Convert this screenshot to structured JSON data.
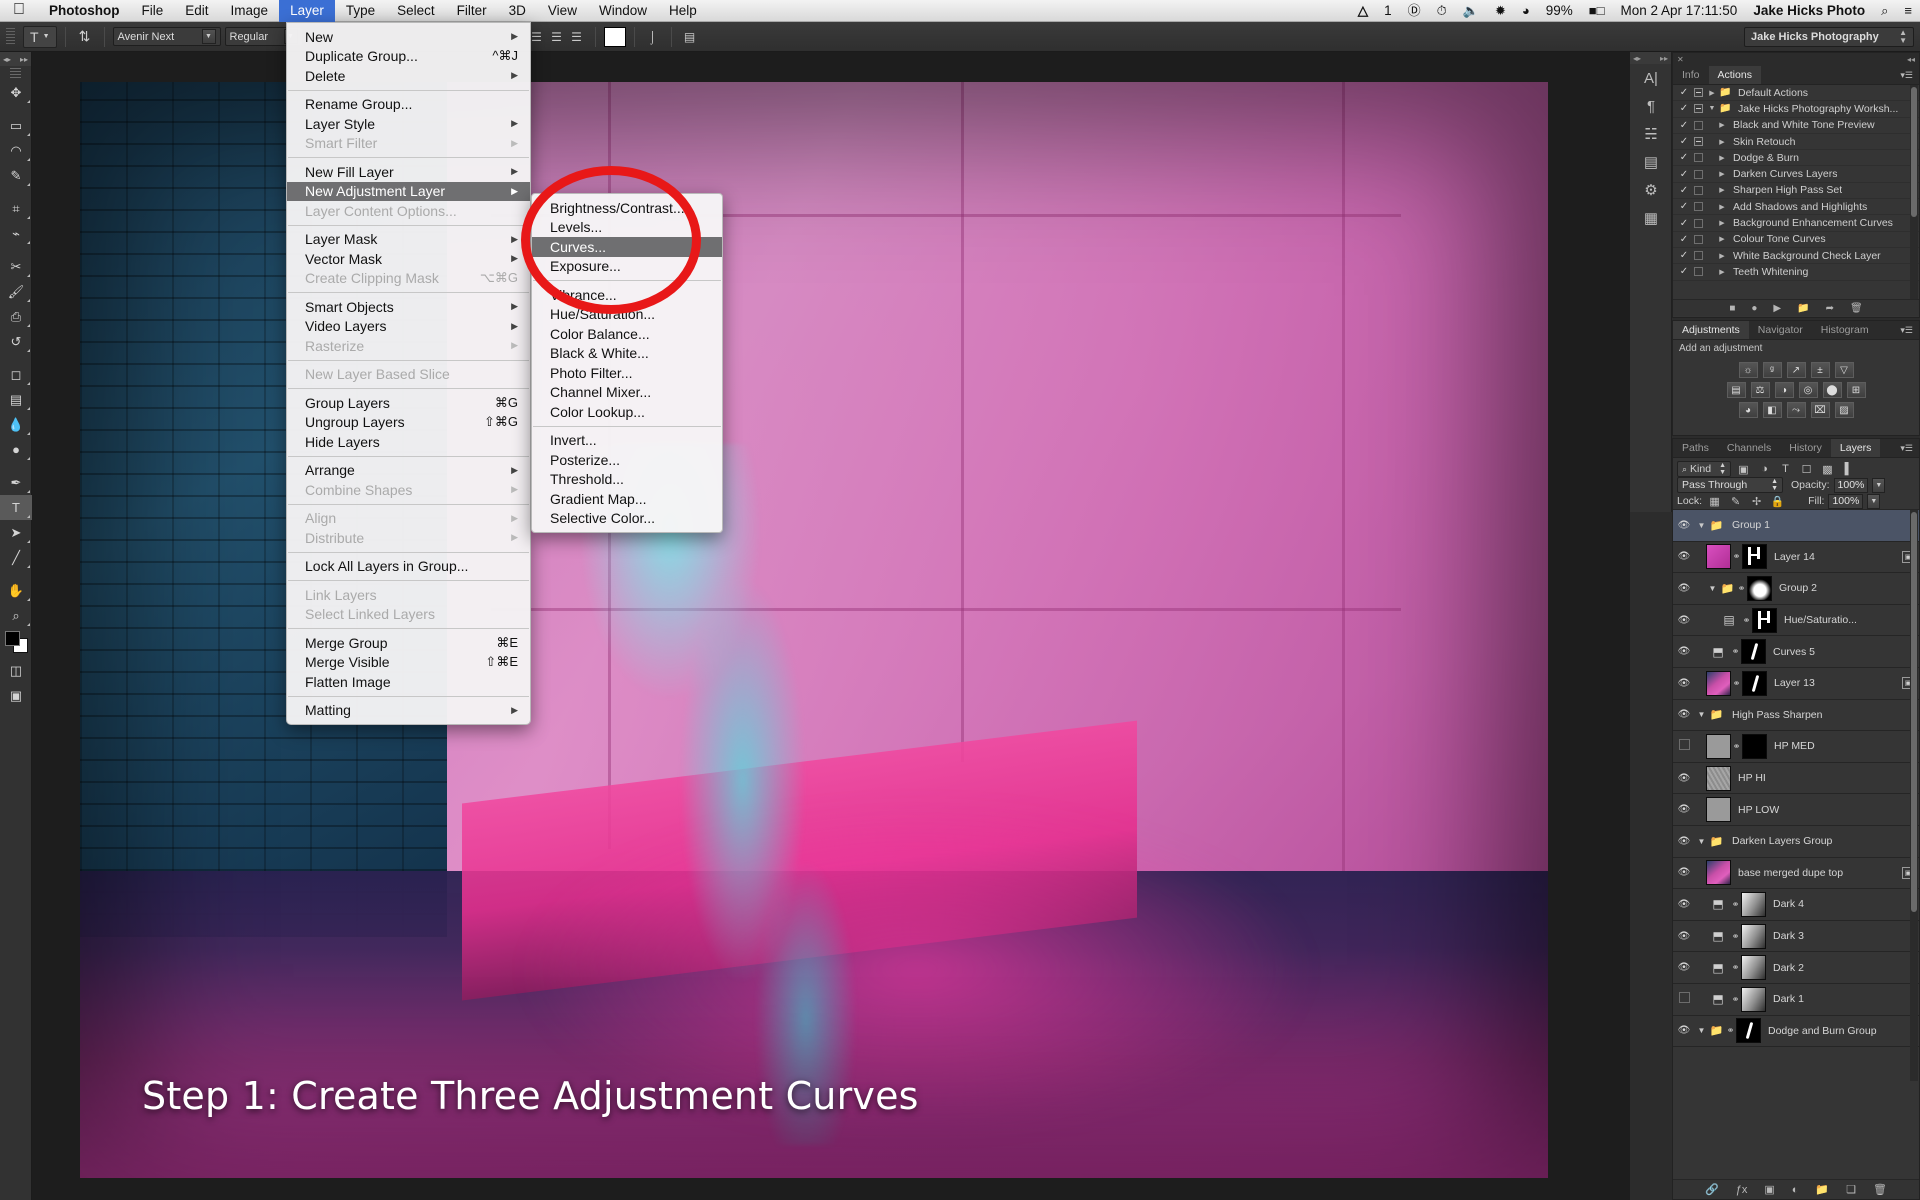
{
  "macbar": {
    "apple_icon": "apple-icon",
    "app_name": "Photoshop",
    "menus": [
      "File",
      "Edit",
      "Image",
      "Layer",
      "Type",
      "Select",
      "Filter",
      "3D",
      "View",
      "Window",
      "Help"
    ],
    "active_menu": "Layer",
    "status": {
      "adobe_count": "1",
      "adobe_icon": "adobe-cc-icon",
      "accessibility_icon": "accessibility-icon",
      "timemachine_icon": "time-machine-icon",
      "volume_icon": "volume-icon",
      "bluetooth_icon": "bluetooth-icon",
      "wifi_icon": "wifi-icon",
      "battery_percent": "99%",
      "battery_icon": "battery-icon",
      "datetime": "Mon 2 Apr  17:11:50",
      "user": "Jake Hicks Photo",
      "search_icon": "search-icon",
      "notification_icon": "notification-center-icon"
    }
  },
  "options_bar": {
    "tool_icon": "type-tool-icon",
    "orientation_icon": "text-orientation-icon",
    "font_family": "Avenir Next",
    "font_style": "Regular",
    "align_left_icon": "align-left-icon",
    "align_center_icon": "align-center-icon",
    "align_right_icon": "align-right-icon",
    "color_swatch": "#ffffff",
    "warp_icon": "warp-text-icon",
    "panels_icon": "toggle-panels-icon",
    "workspace": "Jake Hicks Photography"
  },
  "toolbox": {
    "tools": [
      {
        "name": "move-tool",
        "glyph": "✥"
      },
      {
        "name": "marquee-tool",
        "glyph": "▭"
      },
      {
        "name": "lasso-tool",
        "glyph": "◠"
      },
      {
        "name": "quick-selection-tool",
        "glyph": "✎"
      },
      {
        "name": "crop-tool",
        "glyph": "⌗"
      },
      {
        "name": "eyedropper-tool",
        "glyph": "⌁"
      },
      {
        "name": "spot-healing-tool",
        "glyph": "✂"
      },
      {
        "name": "brush-tool",
        "glyph": "🖌"
      },
      {
        "name": "clone-stamp-tool",
        "glyph": "⎙"
      },
      {
        "name": "history-brush-tool",
        "glyph": "↺"
      },
      {
        "name": "eraser-tool",
        "glyph": "◻"
      },
      {
        "name": "gradient-tool",
        "glyph": "▤"
      },
      {
        "name": "blur-tool",
        "glyph": "💧"
      },
      {
        "name": "dodge-tool",
        "glyph": "●"
      },
      {
        "name": "pen-tool",
        "glyph": "✒"
      },
      {
        "name": "type-tool",
        "glyph": "T",
        "selected": true
      },
      {
        "name": "path-selection-tool",
        "glyph": "➤"
      },
      {
        "name": "line-shape-tool",
        "glyph": "╱"
      },
      {
        "name": "hand-tool",
        "glyph": "✋"
      },
      {
        "name": "zoom-tool",
        "glyph": "⌕"
      }
    ],
    "foreground_color": "#000000",
    "background_color": "#ffffff",
    "quick_mask_icon": "quick-mask-icon",
    "screen_mode_icon": "screen-mode-icon"
  },
  "canvas": {
    "caption": "Step 1: Create Three Adjustment Curves"
  },
  "layer_menu": {
    "items": [
      {
        "label": "New",
        "submenu": true
      },
      {
        "label": "Duplicate Group...",
        "shortcut": "^⌘J"
      },
      {
        "label": "Delete",
        "submenu": true
      },
      {
        "divider": true
      },
      {
        "label": "Rename Group..."
      },
      {
        "label": "Layer Style",
        "submenu": true
      },
      {
        "label": "Smart Filter",
        "disabled": true,
        "submenu": true
      },
      {
        "divider": true
      },
      {
        "label": "New Fill Layer",
        "submenu": true
      },
      {
        "label": "New Adjustment Layer",
        "submenu": true,
        "highlighted": true
      },
      {
        "label": "Layer Content Options...",
        "disabled": true
      },
      {
        "divider": true
      },
      {
        "label": "Layer Mask",
        "submenu": true
      },
      {
        "label": "Vector Mask",
        "submenu": true
      },
      {
        "label": "Create Clipping Mask",
        "shortcut": "⌥⌘G",
        "disabled": true
      },
      {
        "divider": true
      },
      {
        "label": "Smart Objects",
        "submenu": true
      },
      {
        "label": "Video Layers",
        "submenu": true
      },
      {
        "label": "Rasterize",
        "disabled": true,
        "submenu": true
      },
      {
        "divider": true
      },
      {
        "label": "New Layer Based Slice",
        "disabled": true
      },
      {
        "divider": true
      },
      {
        "label": "Group Layers",
        "shortcut": "⌘G"
      },
      {
        "label": "Ungroup Layers",
        "shortcut": "⇧⌘G"
      },
      {
        "label": "Hide Layers"
      },
      {
        "divider": true
      },
      {
        "label": "Arrange",
        "submenu": true
      },
      {
        "label": "Combine Shapes",
        "disabled": true,
        "submenu": true
      },
      {
        "divider": true
      },
      {
        "label": "Align",
        "disabled": true,
        "submenu": true
      },
      {
        "label": "Distribute",
        "disabled": true,
        "submenu": true
      },
      {
        "divider": true
      },
      {
        "label": "Lock All Layers in Group..."
      },
      {
        "divider": true
      },
      {
        "label": "Link Layers",
        "disabled": true
      },
      {
        "label": "Select Linked Layers",
        "disabled": true
      },
      {
        "divider": true
      },
      {
        "label": "Merge Group",
        "shortcut": "⌘E"
      },
      {
        "label": "Merge Visible",
        "shortcut": "⇧⌘E"
      },
      {
        "label": "Flatten Image"
      },
      {
        "divider": true
      },
      {
        "label": "Matting",
        "submenu": true
      }
    ]
  },
  "adjustment_submenu": {
    "items": [
      {
        "label": "Brightness/Contrast..."
      },
      {
        "label": "Levels..."
      },
      {
        "label": "Curves...",
        "highlighted": true
      },
      {
        "label": "Exposure..."
      },
      {
        "divider": true
      },
      {
        "label": "Vibrance..."
      },
      {
        "label": "Hue/Saturation..."
      },
      {
        "label": "Color Balance..."
      },
      {
        "label": "Black & White..."
      },
      {
        "label": "Photo Filter..."
      },
      {
        "label": "Channel Mixer..."
      },
      {
        "label": "Color Lookup..."
      },
      {
        "divider": true
      },
      {
        "label": "Invert..."
      },
      {
        "label": "Posterize..."
      },
      {
        "label": "Threshold..."
      },
      {
        "label": "Gradient Map..."
      },
      {
        "label": "Selective Color..."
      }
    ]
  },
  "annotation": {
    "circle_color": "#e81818",
    "name": "red-highlight-circle"
  },
  "dock": {
    "rail_icons": [
      "character-panel-icon",
      "paragraph-panel-icon",
      "brush-panel-icon",
      "tool-presets-icon",
      "adjustments-rail-icon",
      "3d-panel-icon"
    ],
    "actions_panel": {
      "tabs": [
        "Info",
        "Actions"
      ],
      "active_tab": "Actions",
      "rows": [
        {
          "label": "Default Actions",
          "checked": true,
          "modal": "dash",
          "folder": true,
          "expanded": false,
          "indent": 0
        },
        {
          "label": "Jake Hicks Photography Worksh...",
          "checked": true,
          "modal": "dash",
          "folder": true,
          "expanded": true,
          "indent": 0
        },
        {
          "label": "Black and White Tone Preview",
          "checked": true,
          "modal": "empty",
          "indent": 1
        },
        {
          "label": "Skin Retouch",
          "checked": true,
          "modal": "dash",
          "indent": 1
        },
        {
          "label": "Dodge & Burn",
          "checked": true,
          "modal": "empty",
          "indent": 1
        },
        {
          "label": "Darken Curves Layers",
          "checked": true,
          "modal": "empty",
          "indent": 1
        },
        {
          "label": "Sharpen High Pass Set",
          "checked": true,
          "modal": "empty",
          "indent": 1
        },
        {
          "label": "Add Shadows and Highlights",
          "checked": true,
          "modal": "empty",
          "indent": 1
        },
        {
          "label": "Background Enhancement Curves",
          "checked": true,
          "modal": "empty",
          "indent": 1
        },
        {
          "label": "Colour Tone Curves",
          "checked": true,
          "modal": "empty",
          "indent": 1
        },
        {
          "label": "White Background Check Layer",
          "checked": true,
          "modal": "empty",
          "indent": 1
        },
        {
          "label": "Teeth Whitening",
          "checked": true,
          "modal": "empty",
          "indent": 1
        }
      ],
      "buttons": [
        "stop-icon",
        "record-icon",
        "play-icon",
        "new-set-icon",
        "new-action-icon",
        "delete-icon"
      ]
    },
    "adjustments_panel": {
      "tabs": [
        "Adjustments",
        "Navigator",
        "Histogram"
      ],
      "active_tab": "Adjustments",
      "heading": "Add an adjustment",
      "icons_row1": [
        "brightness-contrast-icon",
        "levels-icon",
        "curves-icon",
        "exposure-icon",
        "vibrance-icon"
      ],
      "icons_row2": [
        "hue-saturation-icon",
        "color-balance-icon",
        "black-white-icon",
        "photo-filter-icon",
        "channel-mixer-icon",
        "color-lookup-icon"
      ],
      "icons_row3": [
        "invert-icon",
        "posterize-icon",
        "threshold-icon",
        "gradient-map-icon",
        "selective-color-icon"
      ]
    },
    "layers_panel": {
      "tabs": [
        "Paths",
        "Channels",
        "History",
        "Layers"
      ],
      "active_tab": "Layers",
      "filter_label": "Kind",
      "filter_icons": [
        "filter-pixel-icon",
        "filter-adjustment-icon",
        "filter-type-icon",
        "filter-shape-icon",
        "filter-smart-icon",
        "filter-toggle-icon"
      ],
      "blend_mode": "Pass Through",
      "opacity_label": "Opacity:",
      "opacity_value": "100%",
      "lock_label": "Lock:",
      "lock_icons": [
        "lock-transparency-icon",
        "lock-image-icon",
        "lock-position-icon",
        "lock-all-icon"
      ],
      "fill_label": "Fill:",
      "fill_value": "100%",
      "layers": [
        {
          "name": "Group 1",
          "type": "group",
          "visible": true,
          "expanded": true,
          "indent": 0,
          "selected": true
        },
        {
          "name": "Layer 14",
          "type": "pixel",
          "visible": true,
          "indent": 1,
          "thumb": "magenta",
          "mask": "figure",
          "linked": true,
          "smart": true
        },
        {
          "name": "Group 2",
          "type": "group",
          "visible": true,
          "expanded": true,
          "indent": 1,
          "mask": "radial",
          "linked": true
        },
        {
          "name": "Hue/Saturatio...",
          "type": "adjustment",
          "visible": true,
          "indent": 2,
          "adjicon": "hue-saturation-icon",
          "mask": "figure",
          "linked": true
        },
        {
          "name": "Curves 5",
          "type": "adjustment",
          "visible": true,
          "indent": 1,
          "adjicon": "curves-icon",
          "mask": "stroke",
          "linked": true
        },
        {
          "name": "Layer 13",
          "type": "pixel",
          "visible": true,
          "indent": 1,
          "thumb": "photo",
          "mask": "stroke",
          "linked": true,
          "smart": true
        },
        {
          "name": "High Pass Sharpen",
          "type": "group",
          "visible": true,
          "expanded": true,
          "indent": 0
        },
        {
          "name": "HP MED",
          "type": "pixel",
          "visible": false,
          "indent": 1,
          "thumb": "grey",
          "mask": "black",
          "linked": true
        },
        {
          "name": "HP HI",
          "type": "pixel",
          "visible": true,
          "indent": 1,
          "thumb": "greydetail"
        },
        {
          "name": "HP LOW",
          "type": "pixel",
          "visible": true,
          "indent": 1,
          "thumb": "grey"
        },
        {
          "name": "Darken Layers Group",
          "type": "group",
          "visible": true,
          "expanded": true,
          "indent": 0
        },
        {
          "name": "base merged dupe top",
          "type": "pixel",
          "visible": true,
          "indent": 1,
          "thumb": "photo",
          "smart": true
        },
        {
          "name": "Dark 4",
          "type": "adjustment",
          "visible": true,
          "indent": 1,
          "adjicon": "curves-icon",
          "mask": "greyphoto",
          "linked": true
        },
        {
          "name": "Dark 3",
          "type": "adjustment",
          "visible": true,
          "indent": 1,
          "adjicon": "curves-icon",
          "mask": "greyphoto",
          "linked": true
        },
        {
          "name": "Dark 2",
          "type": "adjustment",
          "visible": true,
          "indent": 1,
          "adjicon": "curves-icon",
          "mask": "greyphoto",
          "linked": true
        },
        {
          "name": "Dark 1",
          "type": "adjustment",
          "visible": false,
          "indent": 1,
          "adjicon": "curves-icon",
          "mask": "greyphoto",
          "linked": true
        },
        {
          "name": "Dodge and Burn Group",
          "type": "group",
          "visible": true,
          "expanded": true,
          "indent": 0,
          "mask": "stroke",
          "linked": true
        }
      ],
      "buttons": [
        "link-layers-icon",
        "layer-style-icon",
        "add-mask-icon",
        "new-adjustment-icon",
        "new-group-icon",
        "new-layer-icon",
        "delete-layer-icon"
      ]
    }
  }
}
